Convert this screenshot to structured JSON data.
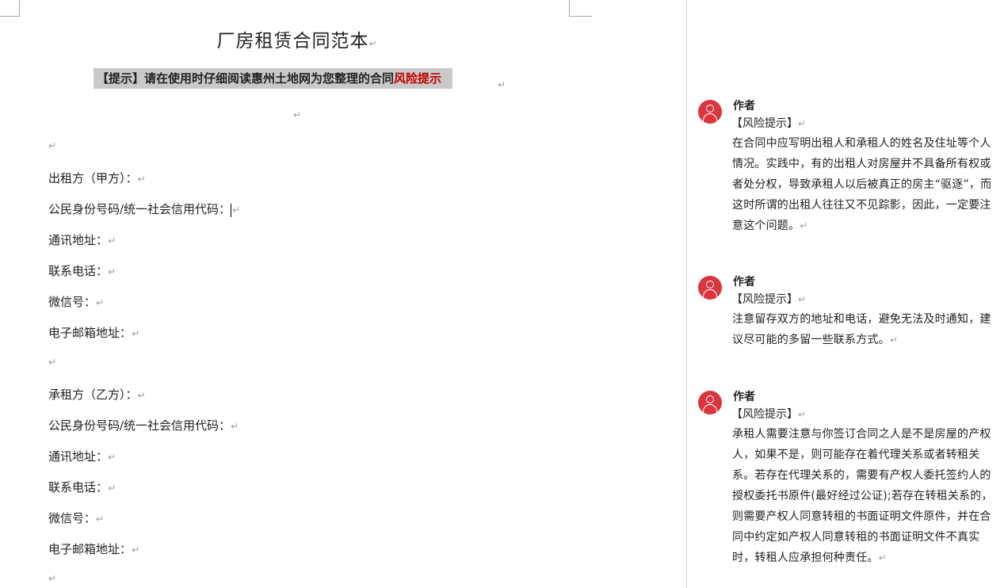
{
  "document": {
    "title": "厂房租赁合同范本",
    "paragraph_mark": "↵",
    "notice": {
      "prefix": "【提示】请在使用时仔细阅读惠州土地网为您整理的合同",
      "highlight": "风险提示"
    },
    "party_a": {
      "heading": "出租方（甲方）：",
      "id_code": "公民身份号码/统一社会信用代码：",
      "address": "通讯地址：",
      "phone": "联系电话：",
      "wechat": "微信号：",
      "email": "电子邮箱地址："
    },
    "party_b": {
      "heading": "承租方（乙方）：",
      "id_code": "公民身份号码/统一社会信用代码：",
      "address": "通讯地址：",
      "phone": "联系电话：",
      "wechat": "微信号：",
      "email": "电子邮箱地址："
    }
  },
  "comments": [
    {
      "author": "作者",
      "tag": "【风险提示】",
      "body": "在合同中应写明出租人和承租人的姓名及住址等个人情况。实践中，有的出租人对房屋并不具备所有权或者处分权，导致承租人以后被真正的房主“驱逐”，而这时所谓的出租人往往又不见踪影，因此，一定要注意这个问题。"
    },
    {
      "author": "作者",
      "tag": "【风险提示】",
      "body": "注意留存双方的地址和电话，避免无法及时通知，建议尽可能的多留一些联系方式。"
    },
    {
      "author": "作者",
      "tag": "【风险提示】",
      "body": "承租人需要注意与你签订合同之人是不是房屋的产权人，如果不是，则可能存在着代理关系或者转租关系。若存在代理关系的，需要有产权人委托签约人的授权委托书原件(最好经过公证);若存在转租关系的，则需要产权人同意转租的书面证明文件原件，并在合同中约定如产权人同意转租的书面证明文件不真实时，转租人应承担何种责任。"
    }
  ],
  "colors": {
    "notice_bg": "#c9c9c9",
    "highlight_red": "#c00000",
    "avatar_red": "#d9363e"
  }
}
